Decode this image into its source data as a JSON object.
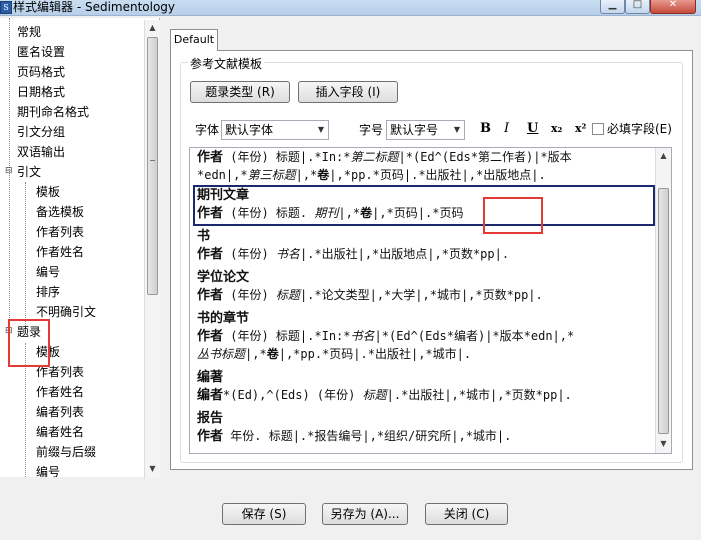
{
  "window": {
    "title": "样式编辑器 - Sedimentology",
    "app_icon": "S"
  },
  "sidebar": {
    "items": [
      {
        "label": "常规"
      },
      {
        "label": "匿名设置"
      },
      {
        "label": "页码格式"
      },
      {
        "label": "日期格式"
      },
      {
        "label": "期刊命名格式"
      },
      {
        "label": "引文分组"
      },
      {
        "label": "双语输出"
      },
      {
        "label": "引文",
        "expander": "⊟"
      },
      {
        "label": "模板"
      },
      {
        "label": "备选模板"
      },
      {
        "label": "作者列表"
      },
      {
        "label": "作者姓名"
      },
      {
        "label": "编号"
      },
      {
        "label": "排序"
      },
      {
        "label": "不明确引文"
      },
      {
        "label": "题录",
        "expander": "⊟"
      },
      {
        "label": "模板"
      },
      {
        "label": "作者列表"
      },
      {
        "label": "作者姓名"
      },
      {
        "label": "编者列表"
      },
      {
        "label": "编者姓名"
      },
      {
        "label": "前缀与后缀"
      },
      {
        "label": "编号"
      }
    ]
  },
  "tab": {
    "label": "Default"
  },
  "group": {
    "label": "参考文献模板"
  },
  "toolbar": {
    "ref_type_button": "题录类型 (R)",
    "insert_field_button": "插入字段 (I)",
    "font_label": "字体",
    "font_value": "默认字体",
    "size_label": "字号",
    "size_value": "默认字号",
    "bold": "B",
    "italic": "I",
    "underline": "U",
    "subscript": "x₂",
    "superscript": "x²",
    "required_field_label": "必填字段(E)"
  },
  "editor": {
    "lines": [
      [
        {
          "t": "作者",
          "c": "head"
        },
        {
          "t": " (年份) 标题|.*In:*"
        },
        {
          "t": "第二标题",
          "c": "it"
        },
        {
          "t": "|*(Ed^(Eds*第二作者)|*版本"
        }
      ],
      [
        {
          "t": "*edn|,*"
        },
        {
          "t": "第三标题",
          "c": "it"
        },
        {
          "t": "|,*"
        },
        {
          "t": "卷",
          "c": "b"
        },
        {
          "t": "|,*pp.*页码|.*出版社|,*出版地点|."
        }
      ],
      [
        {
          "t": "期刊文章",
          "c": "head"
        }
      ],
      [
        {
          "t": "作者",
          "c": "head"
        },
        {
          "t": " (年份) 标题. "
        },
        {
          "t": "期刊",
          "c": "it"
        },
        {
          "t": "|,*"
        },
        {
          "t": "卷",
          "c": "b"
        },
        {
          "t": "|,*页码|.*页码"
        }
      ],
      [
        {
          "t": "书",
          "c": "head"
        }
      ],
      [
        {
          "t": "作者",
          "c": "head"
        },
        {
          "t": " (年份) "
        },
        {
          "t": "书名",
          "c": "it"
        },
        {
          "t": "|.*出版社|,*出版地点|,*页数*pp|."
        }
      ],
      [
        {
          "t": "学位论文",
          "c": "head"
        }
      ],
      [
        {
          "t": "作者",
          "c": "head"
        },
        {
          "t": " (年份) "
        },
        {
          "t": "标题",
          "c": "it"
        },
        {
          "t": "|.*论文类型|,*大学|,*城市|,*页数*pp|."
        }
      ],
      [
        {
          "t": "书的章节",
          "c": "head"
        }
      ],
      [
        {
          "t": "作者",
          "c": "head"
        },
        {
          "t": " (年份) 标题|.*In:*"
        },
        {
          "t": "书名",
          "c": "it"
        },
        {
          "t": "|*(Ed^(Eds*编者)|*版本*edn|,*"
        }
      ],
      [
        {
          "t": "丛书标题",
          "c": "it"
        },
        {
          "t": "|,*"
        },
        {
          "t": "卷",
          "c": "b"
        },
        {
          "t": "|,*pp.*页码|.*出版社|,*城市|."
        }
      ],
      [
        {
          "t": "编著",
          "c": "head"
        }
      ],
      [
        {
          "t": "编者",
          "c": "head"
        },
        {
          "t": "*(Ed),^(Eds) (年份) "
        },
        {
          "t": "标题",
          "c": "it"
        },
        {
          "t": "|.*出版社|,*城市|,*页数*pp|."
        }
      ],
      [
        {
          "t": "报告",
          "c": "head"
        }
      ],
      [
        {
          "t": "作者",
          "c": "head"
        },
        {
          "t": " 年份. 标题|.*报告编号|,*组织/研究所|,*城市|."
        }
      ]
    ]
  },
  "footer": {
    "save_button": "保存 (S)",
    "save_as_button": "另存为 (A)...",
    "close_button": "关闭 (C)"
  }
}
